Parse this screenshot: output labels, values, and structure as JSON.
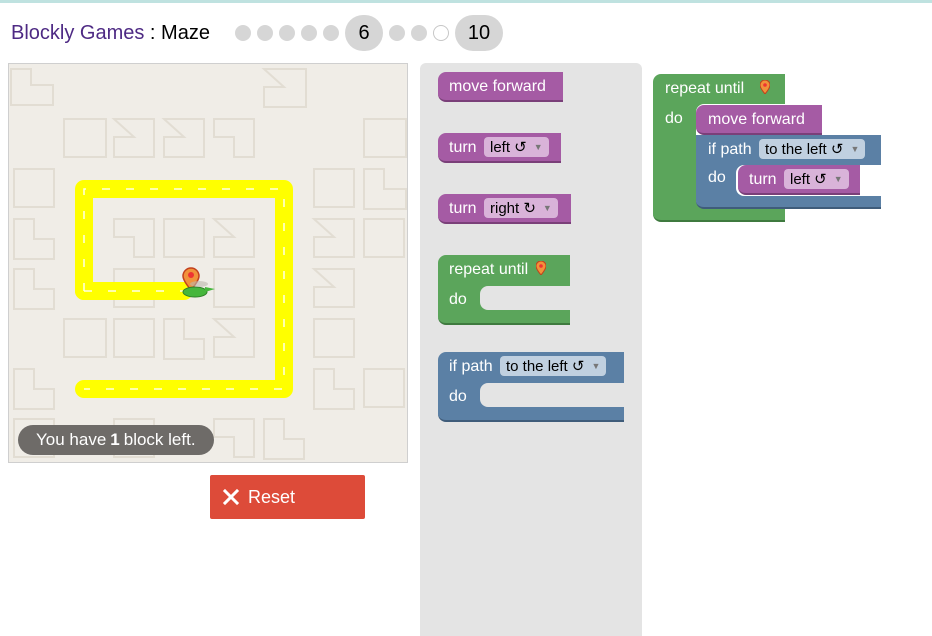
{
  "header": {
    "app_title": "Blockly Games",
    "separator": " : ",
    "game_title": "Maze",
    "current_level": "6",
    "last_level": "10"
  },
  "message": {
    "prefix": "You have",
    "count": "1",
    "suffix": "block left."
  },
  "buttons": {
    "reset_label": "Reset"
  },
  "toolbox": {
    "move_forward": "move forward",
    "turn": "turn",
    "left_option": "left ↺",
    "right_option": "right ↻",
    "repeat_until": "repeat until",
    "do": "do",
    "if_path": "if path",
    "to_the_left": "to the left ↺"
  },
  "workspace": {
    "repeat_until": "repeat until",
    "do": "do",
    "move_forward": "move forward",
    "if_path": "if path",
    "to_the_left": "to the left ↺",
    "do2": "do",
    "turn": "turn",
    "left_option": "left ↺"
  },
  "colors": {
    "movement_block": "#a55ba4",
    "loop_block": "#5ba55b",
    "logic_block": "#5b80a5",
    "path": "#ffff00",
    "reset_button": "#dd4b39",
    "title_link": "#4e2a84"
  },
  "icons": {
    "marker": "marker-icon",
    "reset": "x-icon",
    "pegman": "pegman-icon"
  }
}
